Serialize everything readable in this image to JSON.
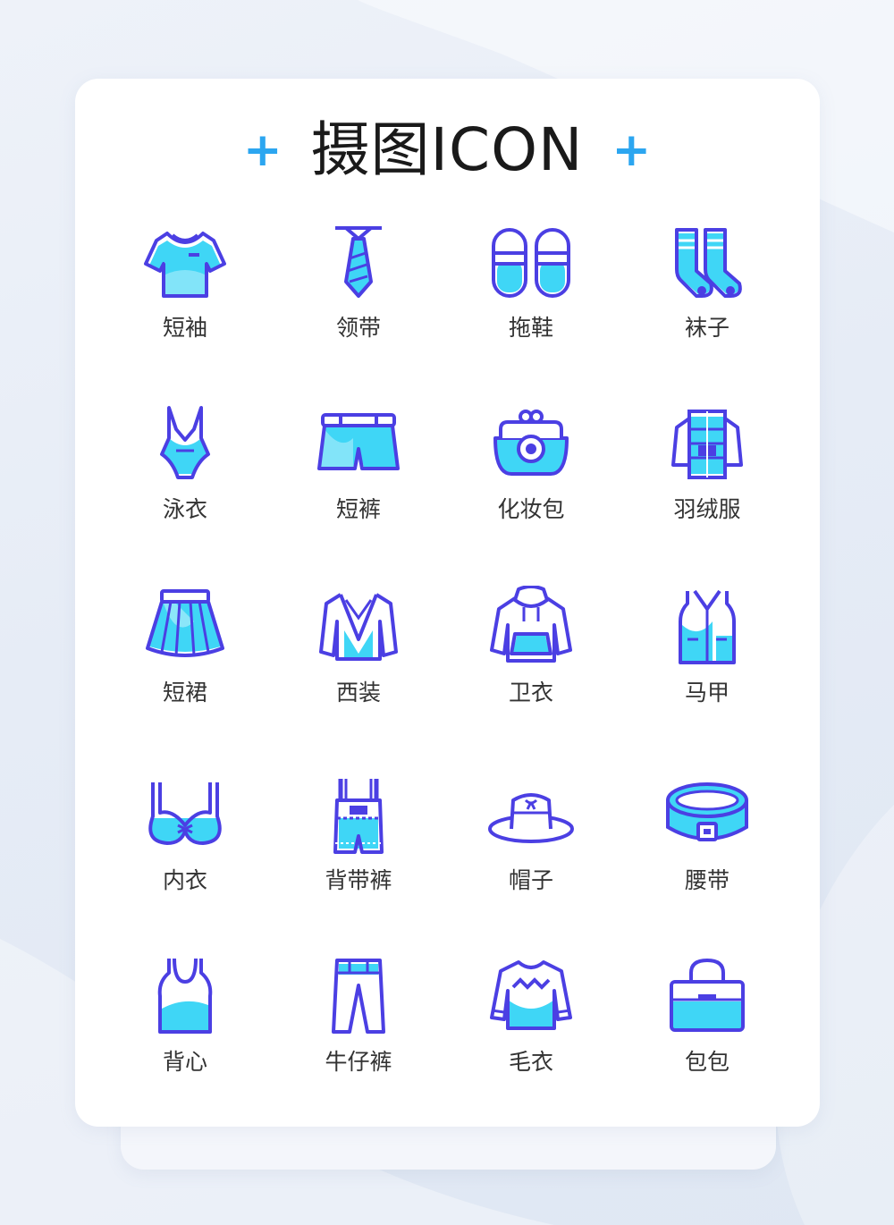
{
  "title": "摄图ICON",
  "decor": {
    "plus_left": "+",
    "plus_right": "+"
  },
  "colors": {
    "stroke": "#4b3fe3",
    "fill": "#3fd6f6",
    "title": "#1a1a1a",
    "plus": "#2ca6f0"
  },
  "icons": [
    {
      "label": "短袖",
      "icon": "short-sleeve-shirt-icon"
    },
    {
      "label": "领带",
      "icon": "tie-icon"
    },
    {
      "label": "拖鞋",
      "icon": "slippers-icon"
    },
    {
      "label": "袜子",
      "icon": "socks-icon"
    },
    {
      "label": "泳衣",
      "icon": "swimsuit-icon"
    },
    {
      "label": "短裤",
      "icon": "shorts-icon"
    },
    {
      "label": "化妆包",
      "icon": "cosmetic-bag-icon"
    },
    {
      "label": "羽绒服",
      "icon": "down-jacket-icon"
    },
    {
      "label": "短裙",
      "icon": "short-skirt-icon"
    },
    {
      "label": "西装",
      "icon": "suit-icon"
    },
    {
      "label": "卫衣",
      "icon": "hoodie-icon"
    },
    {
      "label": "马甲",
      "icon": "vest-icon"
    },
    {
      "label": "内衣",
      "icon": "bra-icon"
    },
    {
      "label": "背带裤",
      "icon": "overalls-icon"
    },
    {
      "label": "帽子",
      "icon": "hat-icon"
    },
    {
      "label": "腰带",
      "icon": "belt-icon"
    },
    {
      "label": "背心",
      "icon": "tank-top-icon"
    },
    {
      "label": "牛仔裤",
      "icon": "jeans-icon"
    },
    {
      "label": "毛衣",
      "icon": "sweater-icon"
    },
    {
      "label": "包包",
      "icon": "handbag-icon"
    }
  ]
}
